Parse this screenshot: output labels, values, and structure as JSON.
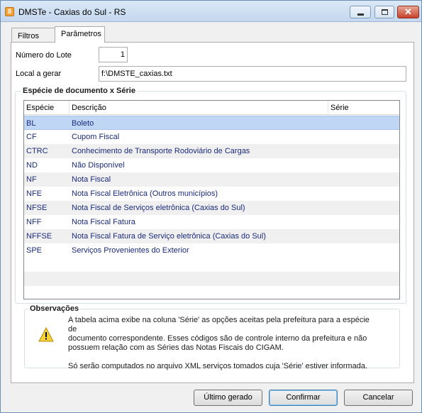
{
  "window": {
    "title": "DMSTe - Caxias do Sul - RS",
    "app_icon_glyph": "8",
    "controls": {
      "minimize_icon": "minimize-icon",
      "maximize_icon": "maximize-icon",
      "close_icon": "close-icon"
    }
  },
  "tabs": [
    {
      "label": "Filtros"
    },
    {
      "label": "Parâmetros",
      "active": true
    }
  ],
  "form": {
    "lote_label": "Número do Lote",
    "lote_value": "1",
    "local_label": "Local a gerar",
    "local_value": "f:\\DMSTE_caxias.txt"
  },
  "especie_group": {
    "title": "Espécie de documento x Série",
    "columns": [
      "Espécie",
      "Descrição",
      "Série"
    ],
    "rows": [
      {
        "especie": "BL",
        "descricao": "Boleto",
        "serie": ""
      },
      {
        "especie": "CF",
        "descricao": "Cupom Fiscal",
        "serie": ""
      },
      {
        "especie": "CTRC",
        "descricao": "Conhecimento de Transporte Rodoviário de Cargas",
        "serie": ""
      },
      {
        "especie": "ND",
        "descricao": "Não Disponível",
        "serie": ""
      },
      {
        "especie": "NF",
        "descricao": "Nota Fiscal",
        "serie": ""
      },
      {
        "especie": "NFE",
        "descricao": "Nota Fiscal Eletrônica (Outros municípios)",
        "serie": ""
      },
      {
        "especie": "NFSE",
        "descricao": "Nota Fiscal de Serviços eletrônica (Caxias do Sul)",
        "serie": ""
      },
      {
        "especie": "NFF",
        "descricao": "Nota Fiscal Fatura",
        "serie": ""
      },
      {
        "especie": "NFFSE",
        "descricao": "Nota Fiscal Fatura de Serviço eletrônica (Caxias do Sul)",
        "serie": ""
      },
      {
        "especie": "SPE",
        "descricao": "Serviços Provenientes do Exterior",
        "serie": ""
      }
    ],
    "selected_row": 0
  },
  "observacoes": {
    "title": "Observações",
    "icon": "warning-icon",
    "line1": "A tabela acima exibe na coluna 'Série' as opções aceitas pela prefeitura para a espécie de",
    "line2": "documento correspondente. Esses códigos são de controle interno da prefeitura e não",
    "line3": "possuem relação com as Séries das Notas Fiscais do CIGAM.",
    "line4": "Só serão computados no arquivo XML serviços tomados cuja 'Série' estiver informada."
  },
  "buttons": {
    "ultimo_gerado": "Último gerado",
    "confirmar": "Confirmar",
    "cancelar": "Cancelar"
  }
}
